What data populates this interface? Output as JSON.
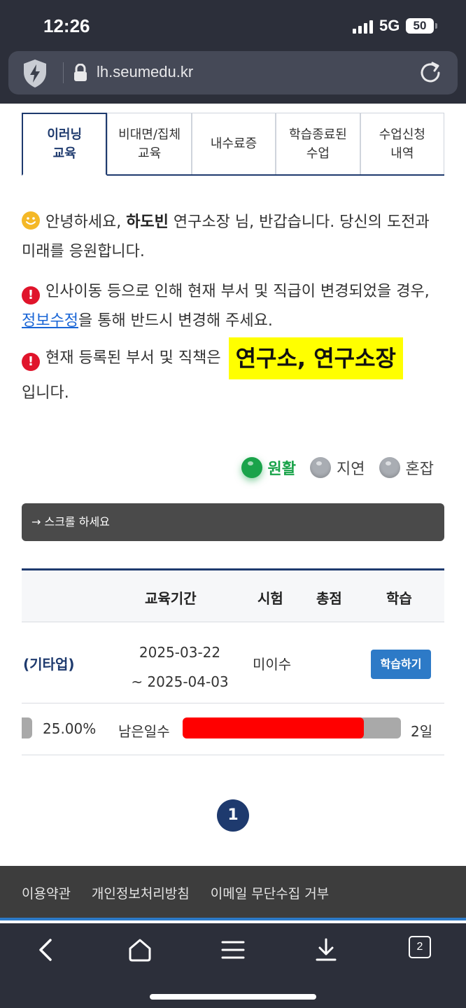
{
  "status": {
    "time": "12:26",
    "network": "5G",
    "battery": "50"
  },
  "browser": {
    "url": "lh.seumedu.kr"
  },
  "tabs": [
    {
      "label": "이러닝\n교육",
      "active": true
    },
    {
      "label": "비대면/집체\n교육"
    },
    {
      "label": "내수료증"
    },
    {
      "label": "학습종료된\n수업"
    },
    {
      "label": "수업신청\n내역"
    }
  ],
  "messages": {
    "greeting_pre": "안녕하세요, ",
    "name": "하도빈",
    "greeting_post": " 연구소장 님, 반갑습니다. 당신의 도전과 미래를 응원합니다.",
    "notice1_pre": "인사이동 등으로 인해 현재 부서 및 직급이 변경되었을 경우, ",
    "notice1_link": "정보수정",
    "notice1_post": "을 통해 반드시 변경해 주세요.",
    "notice2_pre": "현재 등록된 부서 및 직책은 ",
    "notice2_highlight": "연구소, 연구소장",
    "notice2_post": "입니다."
  },
  "legend": {
    "smooth": "원활",
    "delay": "지연",
    "busy": "혼잡"
  },
  "scroll_hint": "→ 스크롤 하세요",
  "table": {
    "headers": {
      "period": "교육기간",
      "exam": "시험",
      "score": "총점",
      "study": "학습"
    },
    "row": {
      "course": "(기타업)",
      "period_start": "2025-03-22",
      "period_end": "~ 2025-04-03",
      "exam": "미이수",
      "study_button": "학습하기",
      "progress": "25.00%",
      "remain_label": "남은일수",
      "remain_fraction": 0.83,
      "remain_days": "2일"
    }
  },
  "pagination": {
    "current": "1"
  },
  "footer": {
    "links": [
      "이용약관",
      "개인정보처리방침",
      "이메일 무단수집 거부"
    ]
  },
  "nav": {
    "tab_count": "2"
  }
}
